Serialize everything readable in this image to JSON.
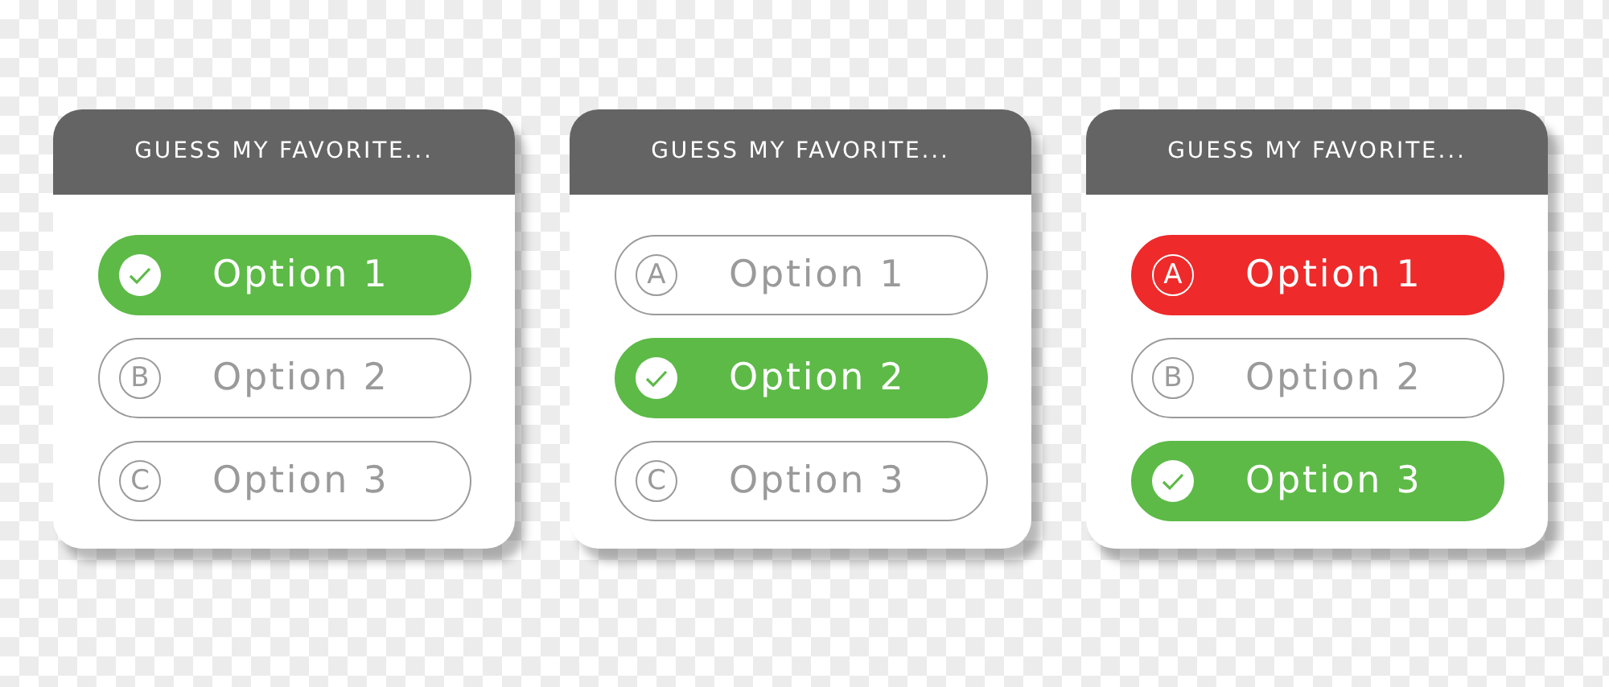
{
  "cards": [
    {
      "title": "GUESS MY FAVORITE...",
      "options": [
        {
          "kind": "correct",
          "label": "Option 1"
        },
        {
          "kind": "plain",
          "letter": "B",
          "label": "Option 2"
        },
        {
          "kind": "plain",
          "letter": "C",
          "label": "Option 3"
        }
      ]
    },
    {
      "title": "GUESS MY FAVORITE...",
      "options": [
        {
          "kind": "plain",
          "letter": "A",
          "label": "Option 1"
        },
        {
          "kind": "correct",
          "label": "Option 2"
        },
        {
          "kind": "plain",
          "letter": "C",
          "label": "Option 3"
        }
      ]
    },
    {
      "title": "GUESS MY FAVORITE...",
      "options": [
        {
          "kind": "wrong",
          "letter": "A",
          "label": "Option 1"
        },
        {
          "kind": "plain",
          "letter": "B",
          "label": "Option 2"
        },
        {
          "kind": "correct",
          "label": "Option 3"
        }
      ]
    }
  ]
}
